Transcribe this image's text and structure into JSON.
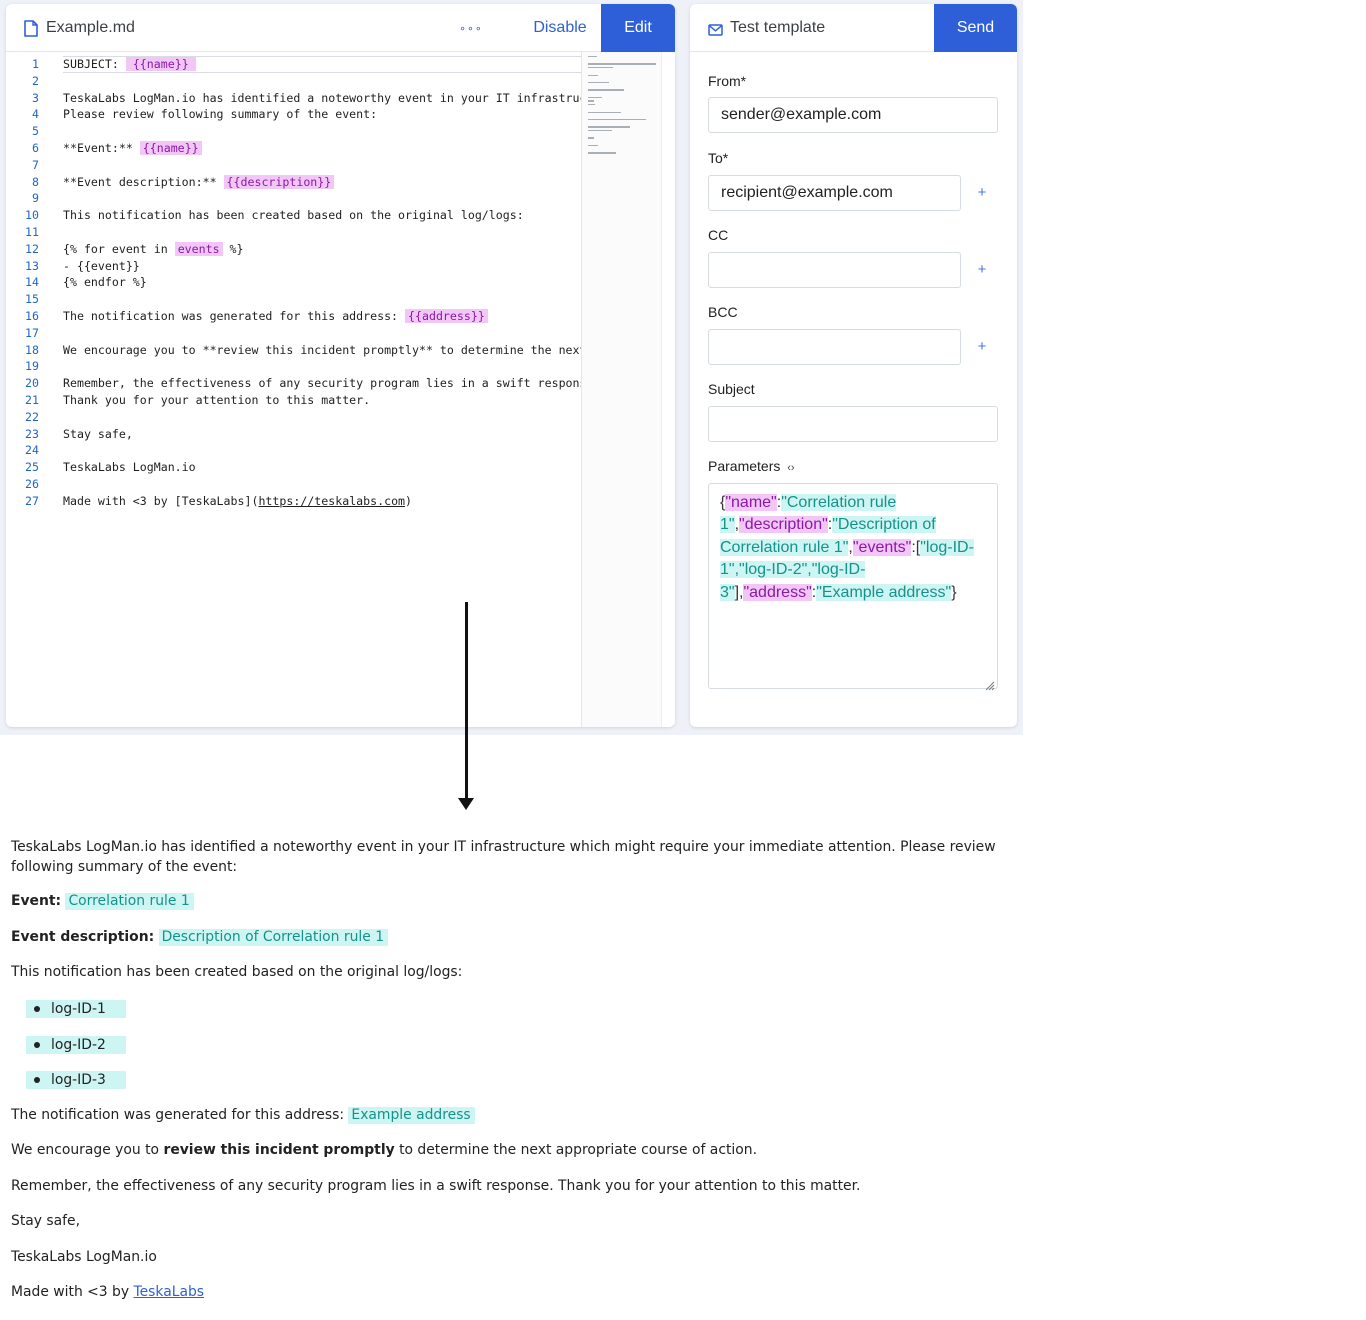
{
  "editor": {
    "filename": "Example.md",
    "more_label": "∘∘∘",
    "disable_label": "Disable",
    "edit_label": "Edit",
    "lines": [
      {
        "n": "1",
        "segments": [
          {
            "t": "SUBJECT: "
          },
          {
            "t": "{{name}}",
            "h": "var-wide"
          }
        ]
      },
      {
        "n": "2",
        "segments": []
      },
      {
        "n": "3",
        "segments": [
          {
            "t": "TeskaLabs LogMan.io has identified a noteworthy event in your IT infrastructure which might require your immediate attention."
          }
        ]
      },
      {
        "n": "4",
        "segments": [
          {
            "t": "Please review following summary of the event:"
          }
        ]
      },
      {
        "n": "5",
        "segments": []
      },
      {
        "n": "6",
        "segments": [
          {
            "t": "**Event:** "
          },
          {
            "t": "{{name}}",
            "h": "var"
          }
        ]
      },
      {
        "n": "7",
        "segments": []
      },
      {
        "n": "8",
        "segments": [
          {
            "t": "**Event description:** "
          },
          {
            "t": "{{description}}",
            "h": "var"
          }
        ]
      },
      {
        "n": "9",
        "segments": []
      },
      {
        "n": "10",
        "segments": [
          {
            "t": "This notification has been created based on the original log/logs:"
          }
        ]
      },
      {
        "n": "11",
        "segments": []
      },
      {
        "n": "12",
        "segments": [
          {
            "t": "{% for event in "
          },
          {
            "t": "events",
            "h": "var"
          },
          {
            "t": " %}"
          }
        ]
      },
      {
        "n": "13",
        "segments": [
          {
            "t": "- {{event}}"
          }
        ]
      },
      {
        "n": "14",
        "segments": [
          {
            "t": "{% endfor %}"
          }
        ]
      },
      {
        "n": "15",
        "segments": []
      },
      {
        "n": "16",
        "segments": [
          {
            "t": "The notification was generated for this address: "
          },
          {
            "t": "{{address}}",
            "h": "var"
          }
        ]
      },
      {
        "n": "17",
        "segments": []
      },
      {
        "n": "18",
        "segments": [
          {
            "t": "We encourage you to **review this incident promptly** to determine the next appropriate course of action."
          }
        ]
      },
      {
        "n": "19",
        "segments": []
      },
      {
        "n": "20",
        "segments": [
          {
            "t": "Remember, the effectiveness of any security program lies in a swift response."
          }
        ]
      },
      {
        "n": "21",
        "segments": [
          {
            "t": "Thank you for your attention to this matter."
          }
        ]
      },
      {
        "n": "22",
        "segments": []
      },
      {
        "n": "23",
        "segments": [
          {
            "t": "Stay safe,"
          }
        ]
      },
      {
        "n": "24",
        "segments": []
      },
      {
        "n": "25",
        "segments": [
          {
            "t": "TeskaLabs LogMan.io"
          }
        ]
      },
      {
        "n": "26",
        "segments": []
      },
      {
        "n": "27",
        "segments": [
          {
            "t": "Made with <3 by [TeskaLabs]("
          },
          {
            "t": "https://teskalabs.com",
            "h": "link"
          },
          {
            "t": ")"
          }
        ]
      }
    ]
  },
  "test_template": {
    "title": "Test template",
    "send_label": "Send",
    "from_label": "From*",
    "from_value": "sender@example.com",
    "to_label": "To*",
    "to_value": "recipient@example.com",
    "cc_label": "CC",
    "cc_value": "",
    "bcc_label": "BCC",
    "bcc_value": "",
    "subject_label": "Subject",
    "subject_value": "",
    "add_symbol": "+",
    "parameters_label": "Parameters",
    "parameters_toggle": "‹›",
    "params_tokens": [
      {
        "t": "{"
      },
      {
        "t": "\"name\"",
        "h": "key"
      },
      {
        "t": ":"
      },
      {
        "t": "\"Correlation rule 1\"",
        "h": "val"
      },
      {
        "t": ","
      },
      {
        "t": "\"description\"",
        "h": "key"
      },
      {
        "t": ":"
      },
      {
        "t": "\"Description of Correlation rule 1\"",
        "h": "val"
      },
      {
        "t": ","
      },
      {
        "t": "\"events\"",
        "h": "key"
      },
      {
        "t": ":["
      },
      {
        "t": "\"log-ID-1\",\"log-ID-2\",\"log-ID-3\"",
        "h": "val"
      },
      {
        "t": "],"
      },
      {
        "t": "\"address\"",
        "h": "key"
      },
      {
        "t": ":"
      },
      {
        "t": "\"Example address\"",
        "h": "val"
      },
      {
        "t": "}"
      }
    ]
  },
  "preview": {
    "intro": "TeskaLabs LogMan.io has identified a noteworthy event in your IT infrastructure which might require your immediate attention. Please review following summary of the event:",
    "event_label": "Event:",
    "event_value": "Correlation rule 1",
    "description_label": "Event description:",
    "description_value": "Description of Correlation rule 1",
    "logs_text": "This notification has been created based on the original log/logs:",
    "events": [
      "log-ID-1",
      "log-ID-2",
      "log-ID-3"
    ],
    "address_text": "The notification was generated for this address:",
    "address_value": "Example address",
    "encourage_before": "We encourage you to",
    "encourage_bold": "review this incident promptly",
    "encourage_after": "to determine the next appropriate course of action.",
    "remember": "Remember, the effectiveness of any security program lies in a swift response. Thank you for your attention to this matter.",
    "stay_safe": "Stay safe,",
    "signature": "TeskaLabs LogMan.io",
    "made_with": "Made with <3 by",
    "made_with_link": "TeskaLabs"
  },
  "colors": {
    "accent": "#2f5fd8",
    "variable_bg": "#f2c6f6",
    "variable_fg": "#8a1aa6",
    "value_bg": "#cdf5f3",
    "value_fg": "#17928a"
  },
  "icons": {
    "file": "file-icon",
    "mail": "mail-icon",
    "more": "more-icon",
    "add": "plus-icon",
    "code_toggle": "code-toggle-icon",
    "resize": "resize-handle-icon",
    "arrow": "arrow-down-icon"
  }
}
